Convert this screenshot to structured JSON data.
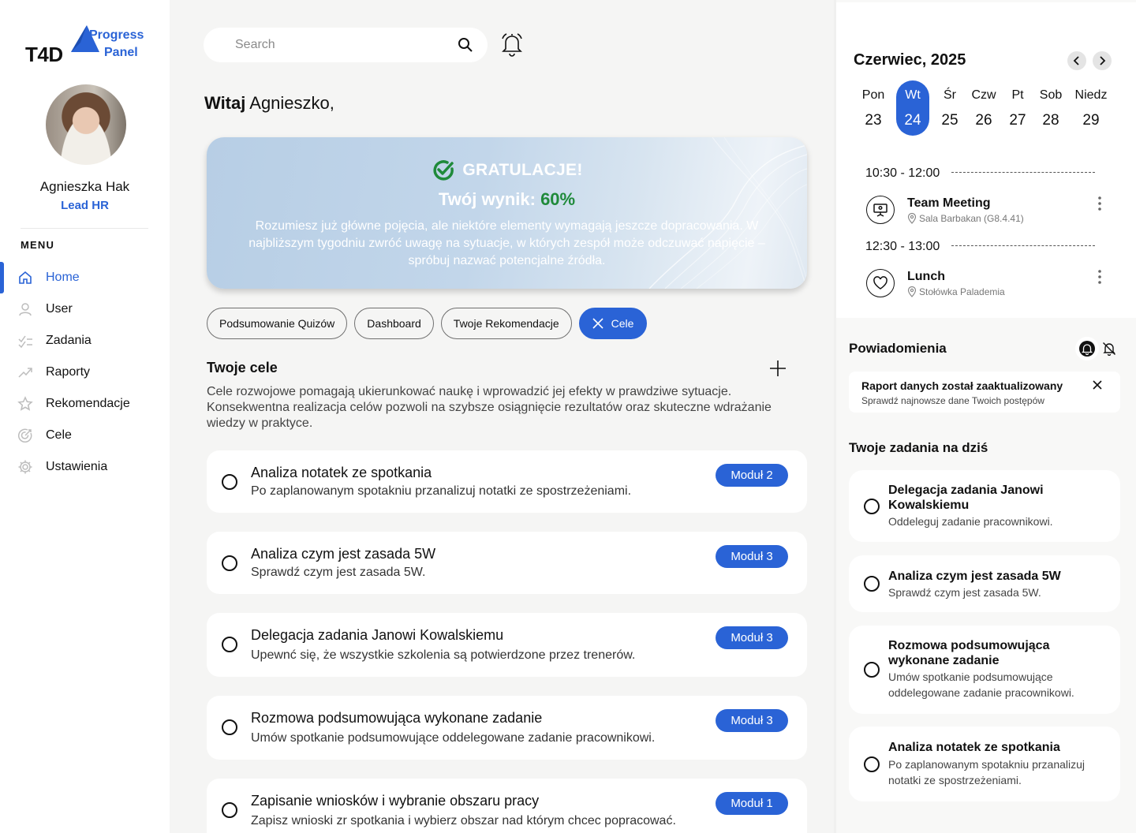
{
  "brand": {
    "logo_text": "T4D",
    "product_line1": "Progress",
    "product_line2": "Panel"
  },
  "user": {
    "name": "Agnieszka Hak",
    "role": "Lead HR"
  },
  "sidebar": {
    "menu_title": "MENU",
    "items": [
      {
        "label": "Home",
        "icon": "home-icon",
        "active": true
      },
      {
        "label": "User",
        "icon": "user-icon"
      },
      {
        "label": "Zadania",
        "icon": "tasks-icon"
      },
      {
        "label": "Raporty",
        "icon": "trend-icon"
      },
      {
        "label": "Rekomendacje",
        "icon": "star-icon"
      },
      {
        "label": "Cele",
        "icon": "target-icon"
      },
      {
        "label": "Ustawienia",
        "icon": "gear-icon"
      }
    ]
  },
  "search": {
    "placeholder": "Search"
  },
  "greeting": {
    "bold": "Witaj",
    "name": "Agnieszko,"
  },
  "banner": {
    "headline": "GRATULACJE!",
    "score_label": "Twój wynik:",
    "score_value": "60%",
    "message": "Rozumiesz już główne pojęcia, ale niektóre elementy wymagają jeszcze dopracowania. W najbliższym tygodniu zwróć uwagę na sytuacje, w których zespół może odczuwać napięcie – spróbuj nazwać potencjalne źródła."
  },
  "tabs": [
    {
      "label": "Podsumowanie Quizów"
    },
    {
      "label": "Dashboard"
    },
    {
      "label": "Twoje Rekomendacje"
    },
    {
      "label": "Cele",
      "active": true
    }
  ],
  "goals": {
    "title": "Twoje cele",
    "description": "Cele rozwojowe pomagają ukierunkować naukę i wprowadzić jej efekty w prawdziwe sytuacje. Konsekwentna realizacja celów pozwoli na szybsze osiągnięcie rezultatów oraz skuteczne wdrażanie wiedzy w praktyce.",
    "items": [
      {
        "title": "Analiza notatek ze spotkania",
        "desc": "Po zaplanowanym spotakniu przanalizuj notatki ze spostrzeżeniami.",
        "module": "Moduł 2"
      },
      {
        "title": "Analiza czym jest zasada 5W",
        "desc": "Sprawdź czym jest zasada 5W.",
        "module": "Moduł 3"
      },
      {
        "title": "Delegacja zadania Janowi Kowalskiemu",
        "desc": "Upewnć się, że wszystkie szkolenia są potwierdzone przez trenerów.",
        "module": "Moduł 3"
      },
      {
        "title": "Rozmowa podsumowująca wykonane zadanie",
        "desc": "Umów spotkanie podsumowujące oddelegowane zadanie pracownikowi.",
        "module": "Moduł 3"
      },
      {
        "title": "Zapisanie wniosków i wybranie obszaru pracy",
        "desc": "Zapisz wnioski zr spotkania i wybierz obszar nad którym chcec popracować.",
        "module": "Moduł 1"
      }
    ]
  },
  "calendar": {
    "month": "Czerwiec, 2025",
    "days": [
      {
        "name": "Pon",
        "date": "23"
      },
      {
        "name": "Wt",
        "date": "24",
        "selected": true
      },
      {
        "name": "Śr",
        "date": "25"
      },
      {
        "name": "Czw",
        "date": "26"
      },
      {
        "name": "Pt",
        "date": "27"
      },
      {
        "name": "Sob",
        "date": "28"
      },
      {
        "name": "Niedz",
        "date": "29"
      }
    ],
    "events": [
      {
        "time": "10:30 - 12:00",
        "title": "Team Meeting",
        "location": "Sala Barbakan (G8.4.41)",
        "icon": "presentation-icon"
      },
      {
        "time": "12:30 - 13:00",
        "title": "Lunch",
        "location": "Stołówka Palademia",
        "icon": "heart-icon"
      }
    ]
  },
  "notifications": {
    "title": "Powiadomienia",
    "items": [
      {
        "title": "Raport danych został zaaktualizowany",
        "desc": "Sprawdź najnowsze dane Twoich postępów"
      }
    ]
  },
  "today_tasks": {
    "title": "Twoje zadania na dziś",
    "items": [
      {
        "title": "Delegacja zadania Janowi Kowalskiemu",
        "desc": "Oddeleguj zadanie pracownikowi."
      },
      {
        "title": "Analiza czym jest zasada 5W",
        "desc": "Sprawdź czym jest zasada 5W."
      },
      {
        "title": "Rozmowa podsumowująca wykonane zadanie",
        "desc": "Umów spotkanie podsumowujące oddelegowane zadanie pracownikowi."
      },
      {
        "title": "Analiza notatek ze spotkania",
        "desc": "Po zaplanowanym spotakniu przanalizuj notatki ze spostrzeżeniami."
      }
    ]
  },
  "colors": {
    "accent": "#2a63d6",
    "success": "#1f8a3a",
    "background": "#f5f5f4"
  }
}
